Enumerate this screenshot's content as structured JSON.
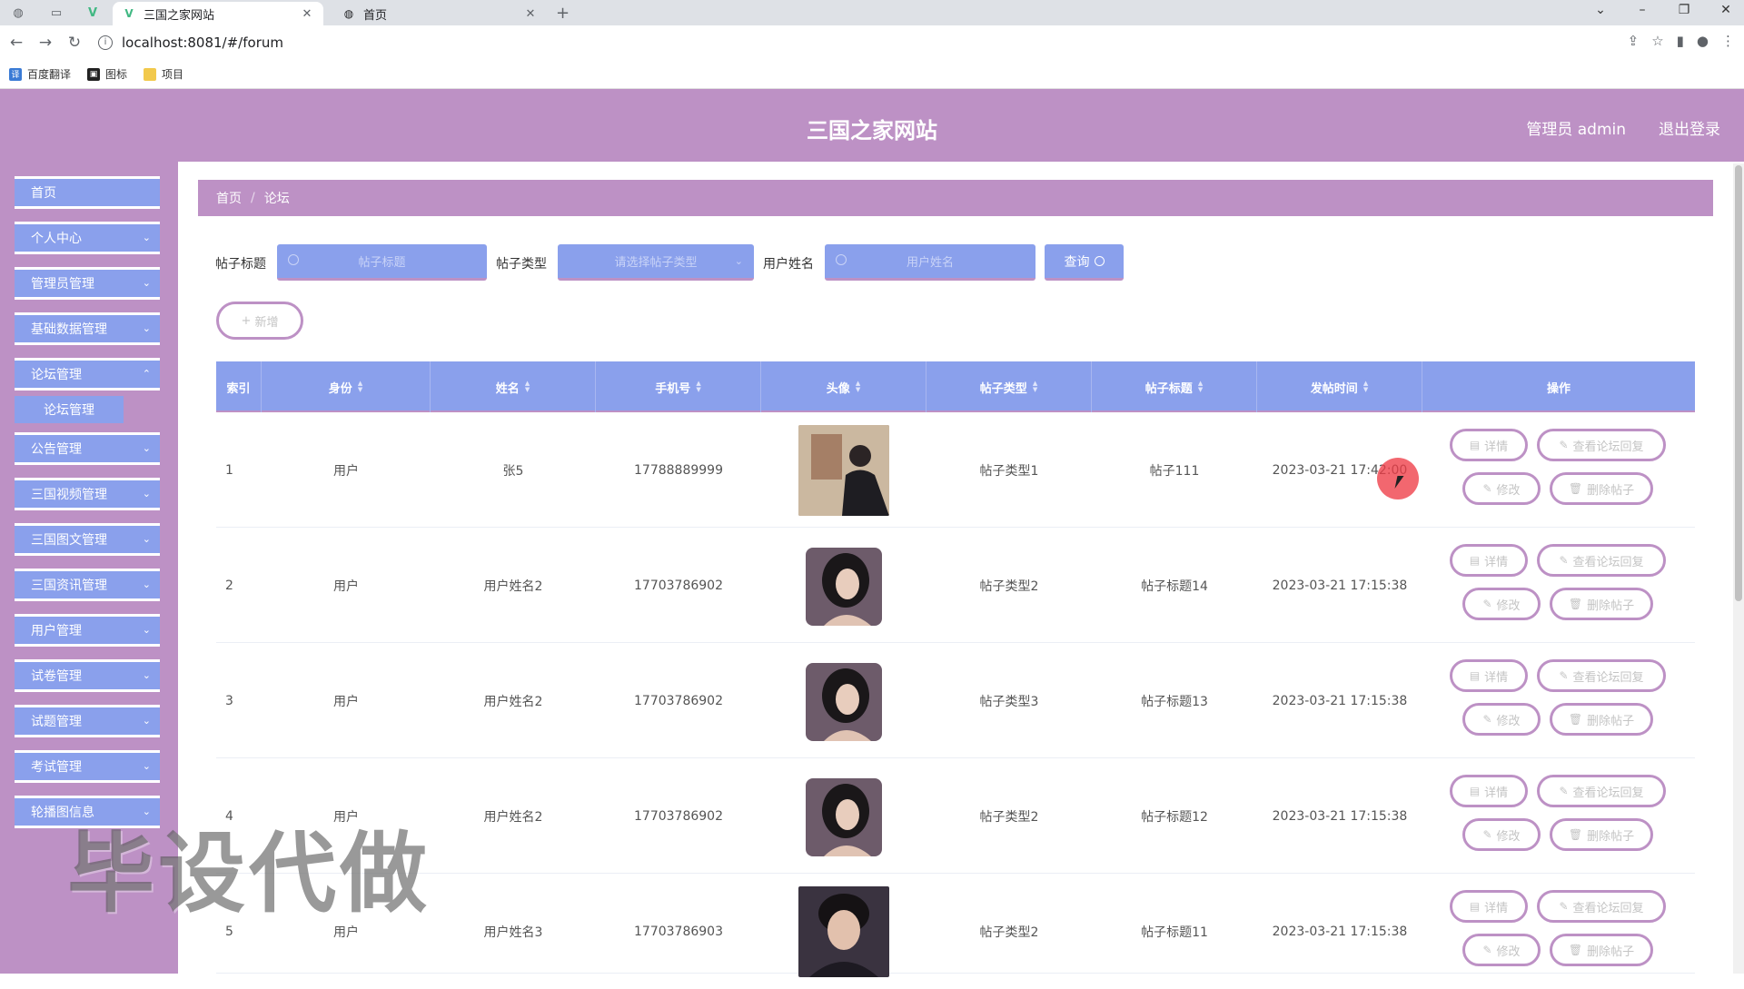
{
  "browser": {
    "tabs": [
      {
        "title": "三国之家网站",
        "active": true
      },
      {
        "title": "首页",
        "active": false
      }
    ],
    "url": "localhost:8081/#/forum",
    "bookmarks": [
      "百度翻译",
      "图标",
      "项目"
    ]
  },
  "header": {
    "title": "三国之家网站",
    "user": "管理员 admin",
    "logout": "退出登录"
  },
  "sidebar": {
    "items": [
      {
        "label": "首页"
      },
      {
        "label": "个人中心"
      },
      {
        "label": "管理员管理"
      },
      {
        "label": "基础数据管理"
      },
      {
        "label": "论坛管理"
      },
      {
        "label": "论坛管理"
      },
      {
        "label": "公告管理"
      },
      {
        "label": "三国视频管理"
      },
      {
        "label": "三国图文管理"
      },
      {
        "label": "三国资讯管理"
      },
      {
        "label": "用户管理"
      },
      {
        "label": "试卷管理"
      },
      {
        "label": "试题管理"
      },
      {
        "label": "考试管理"
      },
      {
        "label": "轮播图信息"
      }
    ]
  },
  "breadcrumb": [
    "首页",
    "论坛"
  ],
  "search": {
    "title_label": "帖子标题",
    "title_placeholder": "帖子标题",
    "type_label": "帖子类型",
    "type_placeholder": "请选择帖子类型",
    "user_label": "用户姓名",
    "user_placeholder": "用户姓名",
    "query_label": "查询"
  },
  "add_label": "新增",
  "table": {
    "headers": [
      "索引",
      "身份",
      "姓名",
      "手机号",
      "头像",
      "帖子类型",
      "帖子标题",
      "发帖时间",
      "操作"
    ],
    "rows": [
      {
        "idx": "1",
        "role": "用户",
        "name": "张5",
        "phone": "17788889999",
        "type": "帖子类型1",
        "title": "帖子111",
        "time": "2023-03-21 17:42:00"
      },
      {
        "idx": "2",
        "role": "用户",
        "name": "用户姓名2",
        "phone": "17703786902",
        "type": "帖子类型2",
        "title": "帖子标题14",
        "time": "2023-03-21 17:15:38"
      },
      {
        "idx": "3",
        "role": "用户",
        "name": "用户姓名2",
        "phone": "17703786902",
        "type": "帖子类型3",
        "title": "帖子标题13",
        "time": "2023-03-21 17:15:38"
      },
      {
        "idx": "4",
        "role": "用户",
        "name": "用户姓名2",
        "phone": "17703786902",
        "type": "帖子类型2",
        "title": "帖子标题12",
        "time": "2023-03-21 17:15:38"
      },
      {
        "idx": "5",
        "role": "用户",
        "name": "用户姓名3",
        "phone": "17703786903",
        "type": "帖子类型2",
        "title": "帖子标题11",
        "time": "2023-03-21 17:15:38"
      }
    ],
    "actions": {
      "detail": "详情",
      "reply": "查看论坛回复",
      "edit": "修改",
      "delete": "删除帖子"
    }
  },
  "watermark": "毕设代做",
  "colors": {
    "accent_purple": "#bd91c5",
    "accent_blue": "#8aa0ec"
  }
}
